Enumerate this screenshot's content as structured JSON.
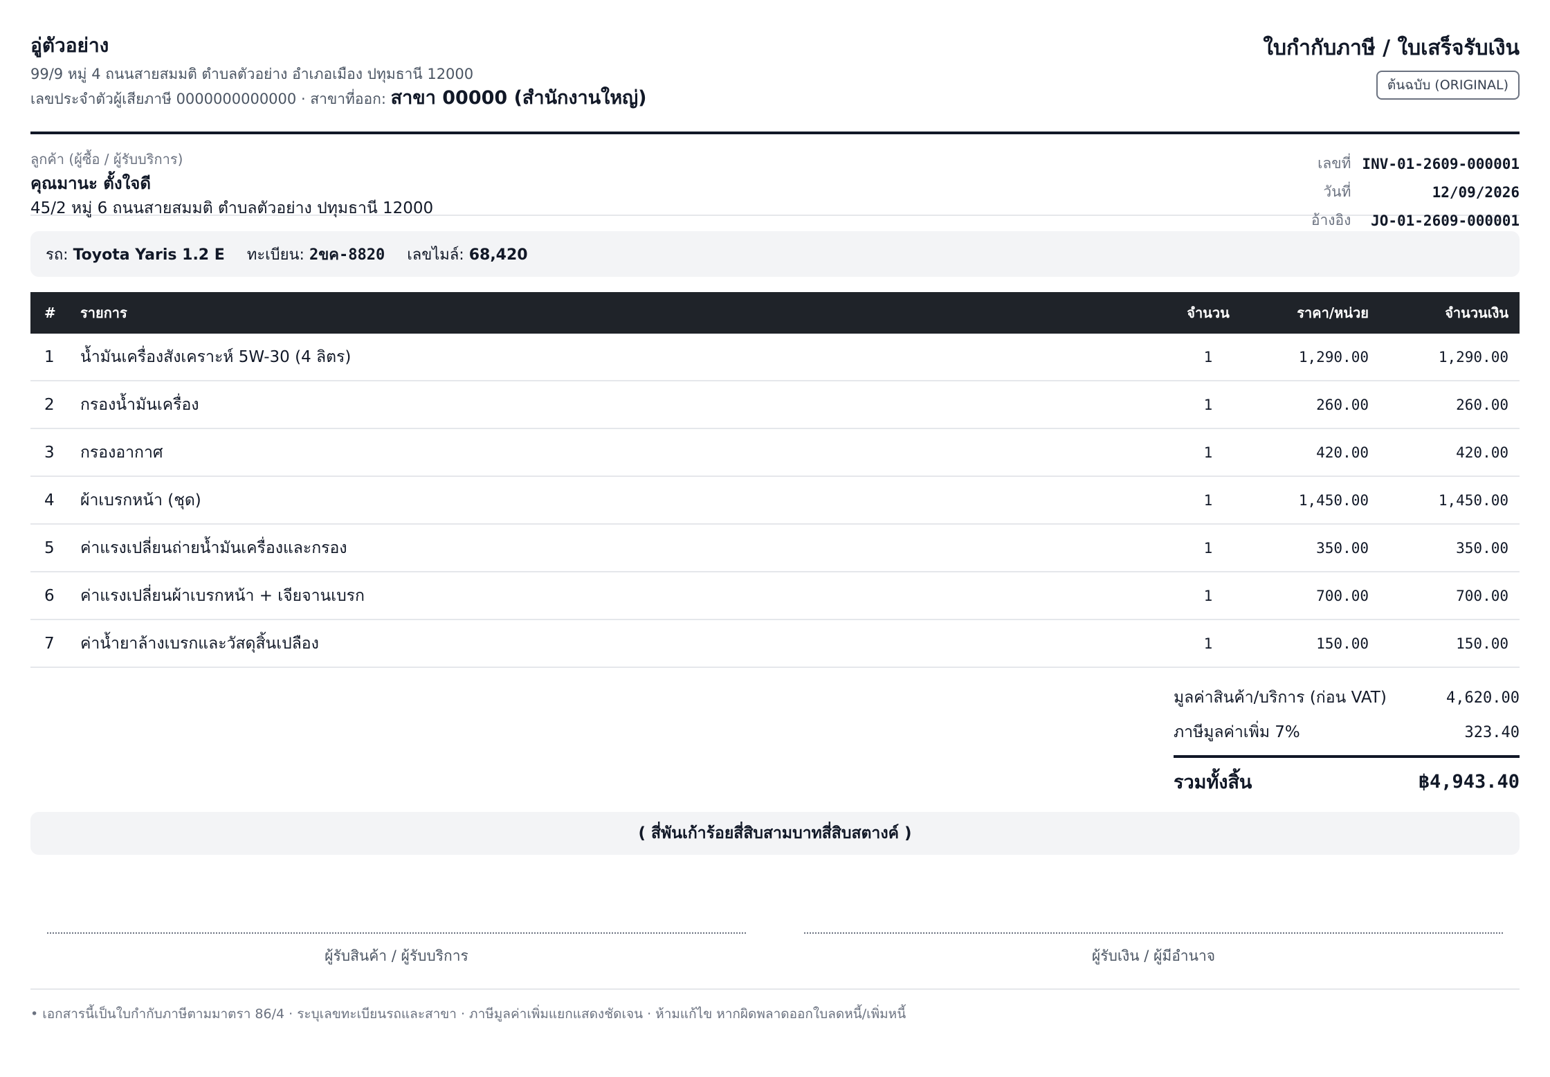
{
  "shop": {
    "name": "อู่ตัวอย่าง",
    "address": "99/9 หมู่ 4 ถนนสายสมมติ ตำบลตัวอย่าง อำเภอเมือง ปทุมธานี 12000",
    "tax_prefix": "เลขประจำตัวผู้เสียภาษี 0000000000000 · สาขาที่ออก:",
    "branch": "สาขา 00000 (สำนักงานใหญ่)"
  },
  "document": {
    "title": "ใบกำกับภาษี / ใบเสร็จรับเงิน",
    "badge": "ต้นฉบับ (ORIGINAL)"
  },
  "customer": {
    "label": "ลูกค้า (ผู้ซื้อ / ผู้รับบริการ)",
    "name": "คุณมานะ ตั้งใจดี",
    "address": "45/2 หมู่ 6 ถนนสายสมมติ ตำบลตัวอย่าง ปทุมธานี 12000"
  },
  "meta": {
    "number_label": "เลขที่",
    "number": "INV-01-2609-000001",
    "date_label": "วันที่",
    "date": "12/09/2026",
    "ref_label": "อ้างอิง",
    "ref": "JO-01-2609-000001"
  },
  "vehicle": {
    "car_label": "รถ:",
    "car": "Toyota Yaris 1.2 E",
    "plate_label": "ทะเบียน:",
    "plate": "2ขค-8820",
    "mileage_label": "เลขไมล์:",
    "mileage": "68,420"
  },
  "table": {
    "headers": {
      "no": "#",
      "item": "รายการ",
      "qty": "จำนวน",
      "price": "ราคา/หน่วย",
      "amount": "จำนวนเงิน"
    },
    "rows": [
      {
        "no": "1",
        "item": "น้ำมันเครื่องสังเคราะห์ 5W-30 (4 ลิตร)",
        "qty": "1",
        "price": "1,290.00",
        "amount": "1,290.00"
      },
      {
        "no": "2",
        "item": "กรองน้ำมันเครื่อง",
        "qty": "1",
        "price": "260.00",
        "amount": "260.00"
      },
      {
        "no": "3",
        "item": "กรองอากาศ",
        "qty": "1",
        "price": "420.00",
        "amount": "420.00"
      },
      {
        "no": "4",
        "item": "ผ้าเบรกหน้า (ชุด)",
        "qty": "1",
        "price": "1,450.00",
        "amount": "1,450.00"
      },
      {
        "no": "5",
        "item": "ค่าแรงเปลี่ยนถ่ายน้ำมันเครื่องและกรอง",
        "qty": "1",
        "price": "350.00",
        "amount": "350.00"
      },
      {
        "no": "6",
        "item": "ค่าแรงเปลี่ยนผ้าเบรกหน้า + เจียจานเบรก",
        "qty": "1",
        "price": "700.00",
        "amount": "700.00"
      },
      {
        "no": "7",
        "item": "ค่าน้ำยาล้างเบรกและวัสดุสิ้นเปลือง",
        "qty": "1",
        "price": "150.00",
        "amount": "150.00"
      }
    ]
  },
  "totals": {
    "subtotal_label": "มูลค่าสินค้า/บริการ (ก่อน VAT)",
    "subtotal": "4,620.00",
    "vat_label": "ภาษีมูลค่าเพิ่ม 7%",
    "vat": "323.40",
    "grand_label": "รวมทั้งสิ้น",
    "grand": "฿4,943.40"
  },
  "amount_words": "( สี่พันเก้าร้อยสี่สิบสามบาทสี่สิบสตางค์ )",
  "signatures": {
    "receiver": "ผู้รับสินค้า / ผู้รับบริการ",
    "collector": "ผู้รับเงิน / ผู้มีอำนาจ"
  },
  "footnote": "• เอกสารนี้เป็นใบกำกับภาษีตามมาตรา 86/4 · ระบุเลขทะเบียนรถและสาขา · ภาษีมูลค่าเพิ่มแยกแสดงชัดเจน · ห้ามแก้ไข หากผิดพลาดออกใบลดหนี้/เพิ่มหนี้"
}
